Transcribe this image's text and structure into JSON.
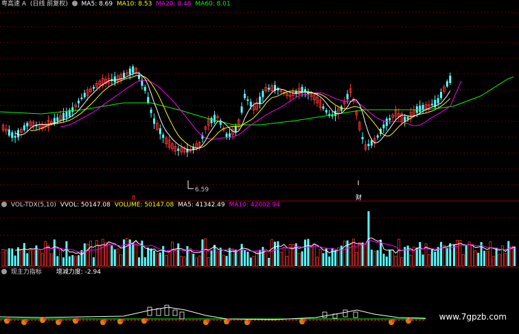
{
  "price_panel": {
    "stock_name": "粤高速 A",
    "period": "(日线 前复权)",
    "ma": [
      {
        "label": "MA5: 8.69",
        "color": "#ffffff"
      },
      {
        "label": "MA10: 8.53",
        "color": "#ffff00"
      },
      {
        "label": "MA20: 8.48",
        "color": "#ff00ff"
      },
      {
        "label": "MA60: 8.01",
        "color": "#00ff00"
      }
    ],
    "low_marker": "6.59",
    "event_red": "8",
    "event_finance": "财"
  },
  "volume_panel": {
    "indicator": "VOL-TDX(5,10)",
    "vvol": "VVOL: 50147.08",
    "volume": "VOLUME: 50147.08",
    "ma5": "MA5: 41342.49",
    "ma10": "MA10: 42002.94"
  },
  "flow_panel": {
    "indicator": "现主力指标",
    "value": "增减力度: -2.94"
  },
  "watermark": "www.7gpzb.com",
  "colors": {
    "up": "#ff3232",
    "down": "#54ffff",
    "grid": "#8b0000",
    "divider": "#a00000",
    "ma5": "#ffffff",
    "ma10": "#ffff00",
    "ma20": "#ff00ff",
    "ma60": "#00ff00"
  }
}
